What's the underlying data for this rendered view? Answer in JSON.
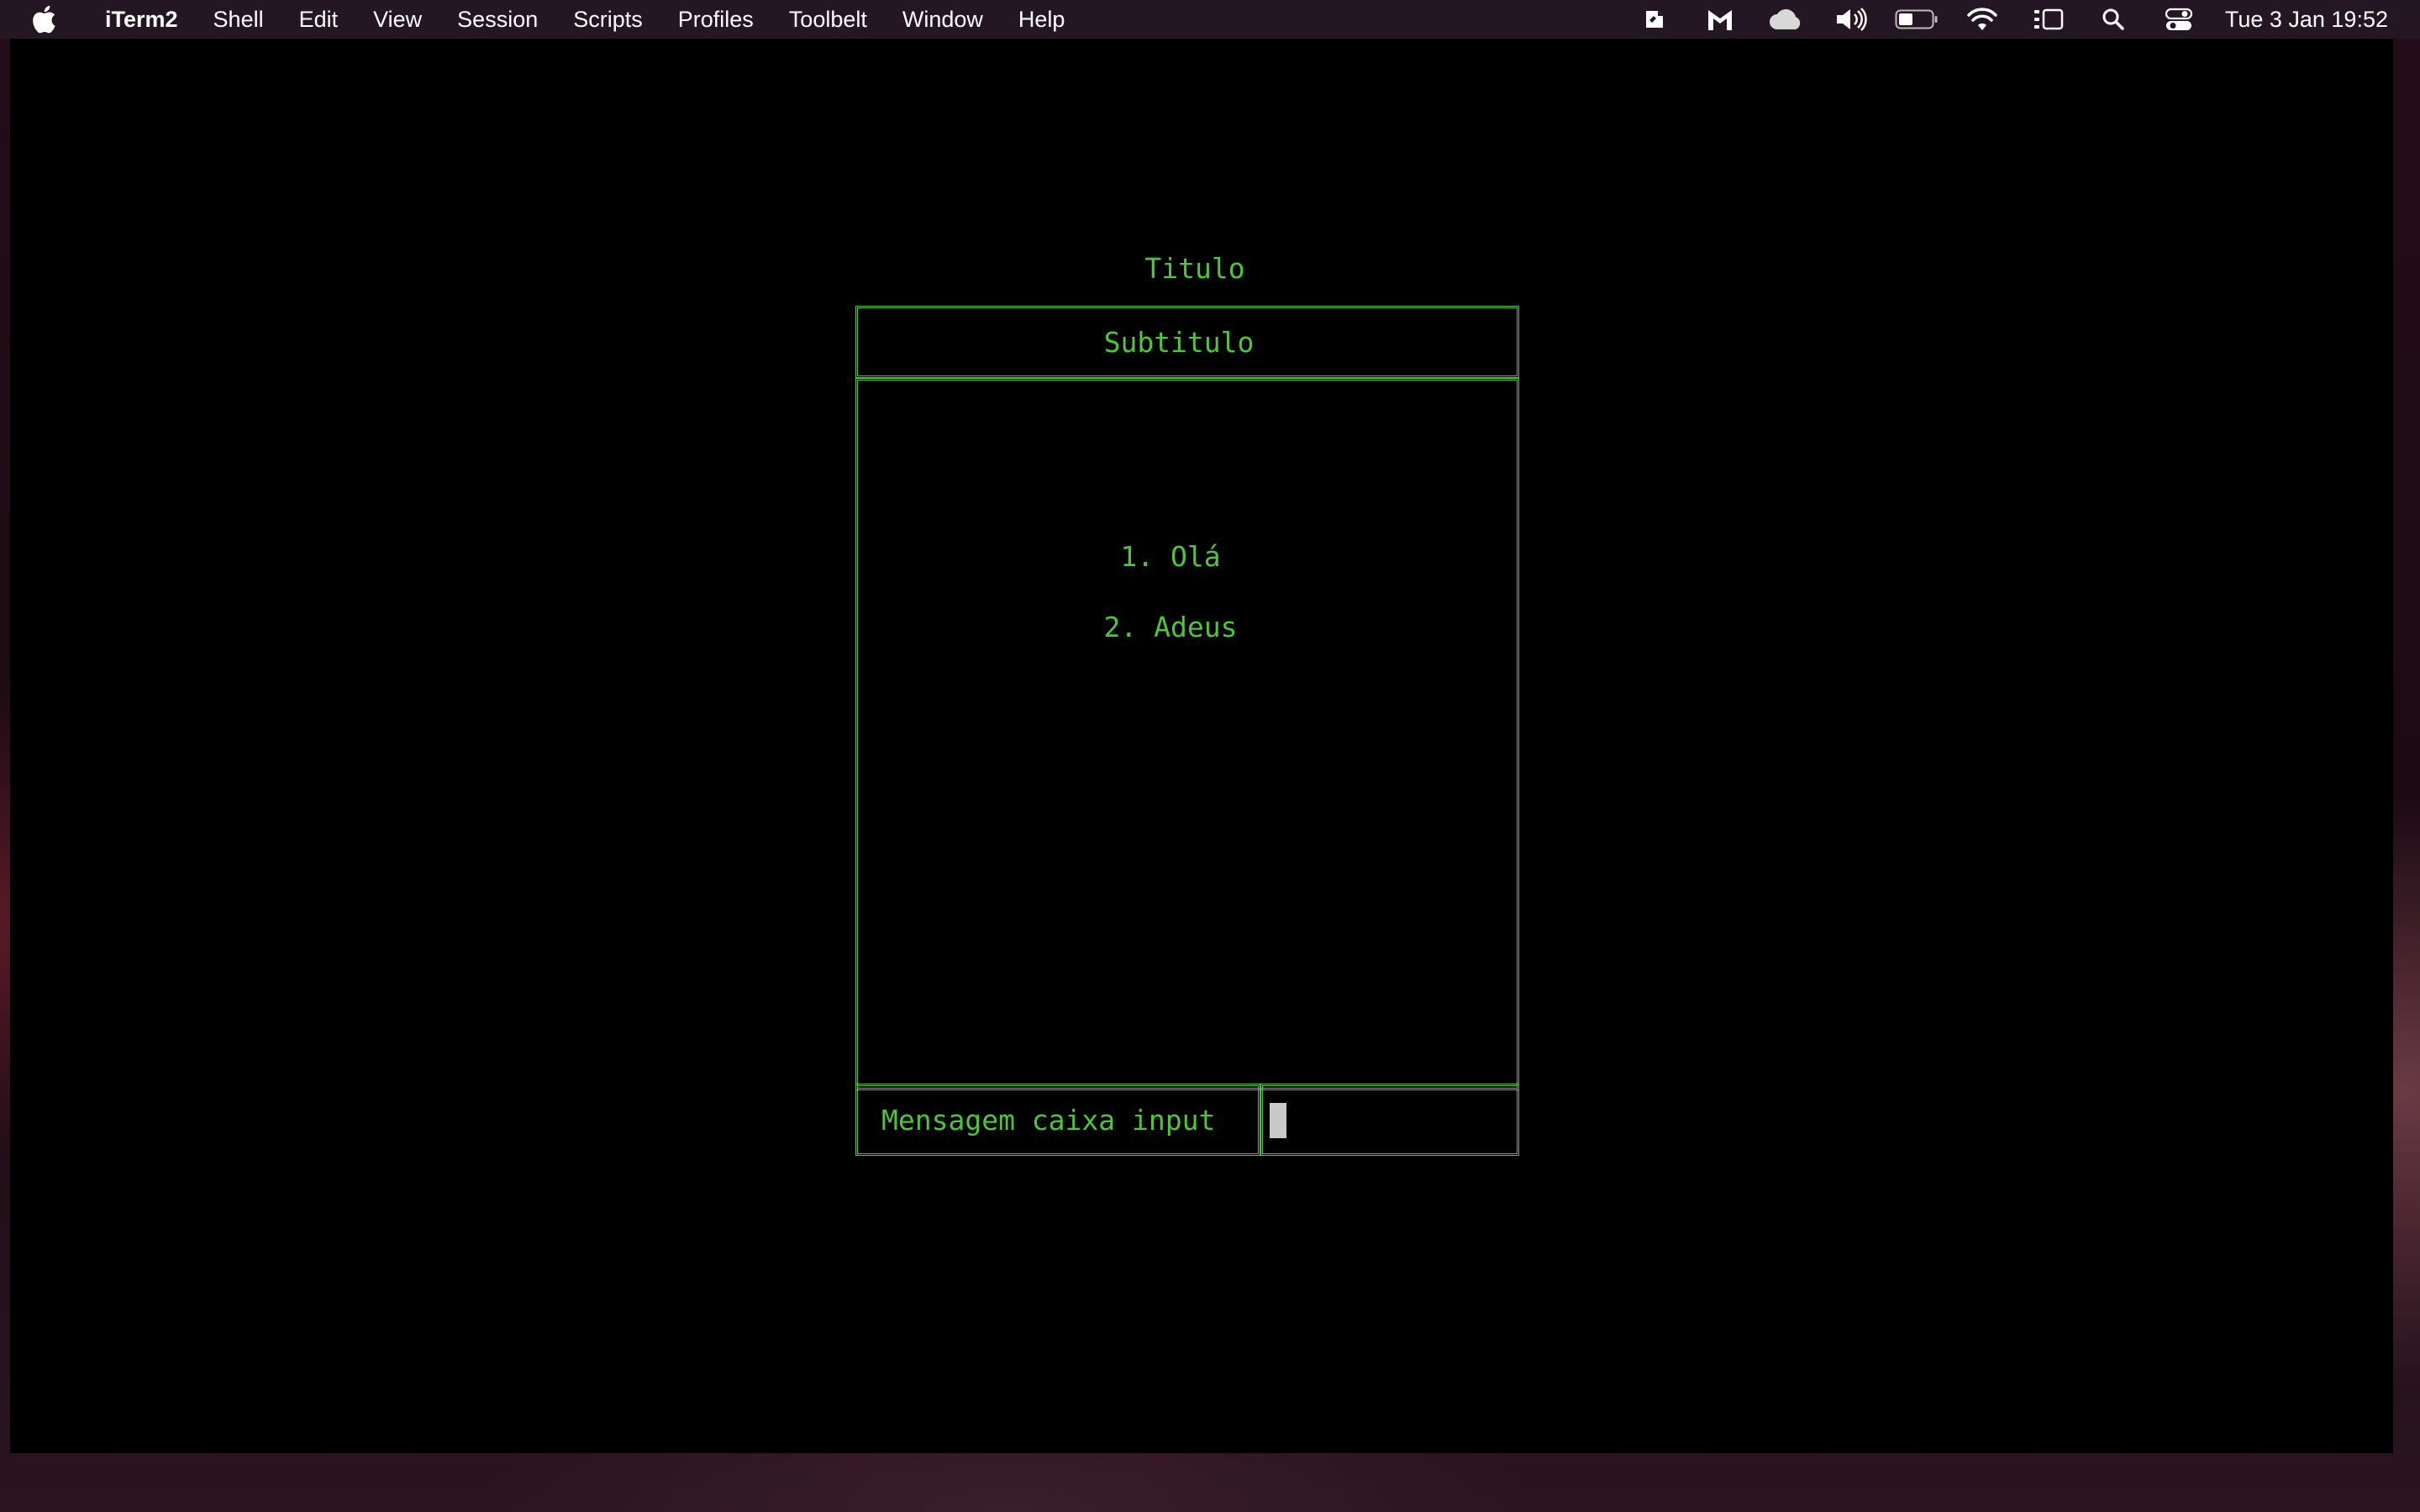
{
  "menubar": {
    "app_name": "iTerm2",
    "items": [
      "Shell",
      "Edit",
      "View",
      "Session",
      "Scripts",
      "Profiles",
      "Toolbelt",
      "Window",
      "Help"
    ],
    "clock": "Tue 3 Jan  19:52",
    "tray_icons": [
      "script-icon",
      "malwarebytes-icon",
      "cloud-icon",
      "volume-icon",
      "battery-icon",
      "wifi-icon",
      "stage-manager-icon",
      "search-icon",
      "control-center-icon"
    ]
  },
  "terminal": {
    "title": "Titulo",
    "subtitle": "Subtitulo",
    "menu_items": [
      "1. Olá",
      "2. Adeus"
    ],
    "input_label": "Mensagem caixa input",
    "input_value": ""
  },
  "colors": {
    "terminal_text": "#4fc63a",
    "terminal_bg": "#000000",
    "menubar_bg": "#241622",
    "cursor": "#c8c8c8"
  }
}
